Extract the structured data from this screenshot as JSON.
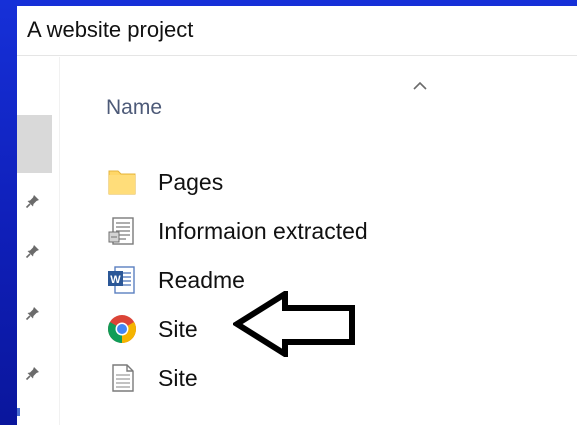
{
  "window": {
    "title": "A website project"
  },
  "columns": {
    "name": "Name"
  },
  "files": [
    {
      "label": "Pages",
      "icon": "folder-icon"
    },
    {
      "label": "Informaion extracted",
      "icon": "text-document-icon"
    },
    {
      "label": "Readme",
      "icon": "word-document-icon"
    },
    {
      "label": "Site",
      "icon": "chrome-icon"
    },
    {
      "label": "Site",
      "icon": "plain-file-icon"
    }
  ],
  "annotation": {
    "icon": "left-arrow-icon",
    "points_to": "Site"
  },
  "colors": {
    "background": "#1630d8",
    "folder": "#ffd768",
    "chrome_red": "#db4437",
    "chrome_yellow": "#f4b400",
    "chrome_green": "#0f9d58",
    "chrome_blue": "#4285f4",
    "word_blue": "#2b5797"
  }
}
